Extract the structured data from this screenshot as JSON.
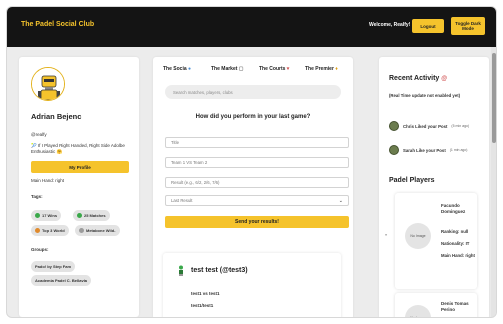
{
  "header": {
    "brand": "The Padel Social Club",
    "welcome": "Welcome, Realfy!",
    "logout_label": "Logout",
    "toggle_dark_label": "Toggle Dark Mode"
  },
  "profile": {
    "name": "Adrian Bejenc",
    "handle": "@realfy",
    "bio": "🎾 If I Played Right Handed, Right Side Adolbe Enthusiastic 🤗",
    "my_profile_label": "My Profile",
    "main_hand": "Main Hand: right",
    "tags_label": "Tags:",
    "tags": [
      {
        "label": "17 Wins",
        "color": "#3aa84a"
      },
      {
        "label": "25 Matches",
        "color": "#3aa84a"
      },
      {
        "label": "Top 3 World",
        "color": "#e08a2c"
      },
      {
        "label": "Metabone Wild-",
        "color": "#9c9c9c"
      }
    ],
    "groups_label": "Groups:",
    "groups": [
      "Pado! by Step Fam",
      "Academia Padel C. Bellavia"
    ]
  },
  "center": {
    "tabs": [
      {
        "label": "The Socia",
        "icon": "globe-icon"
      },
      {
        "label": "The Market",
        "icon": "cart-icon"
      },
      {
        "label": "The Courts",
        "icon": "pin-icon"
      },
      {
        "label": "The Premier",
        "icon": "trophy-icon"
      }
    ],
    "search_placeholder": "Search matches, players, clubs",
    "form_title": "How did you perform in your last game?",
    "fields": [
      {
        "placeholder": "Title"
      },
      {
        "placeholder": "Team 1 VS Team 2"
      },
      {
        "placeholder": "Result (e.g., 6/2, 2/6, 7/6)"
      }
    ],
    "select_value": "Last Result",
    "submit_label": "Send your results!",
    "post": {
      "author": "test test (@test3)",
      "line1": "test1 vs test1",
      "line2": "test1/test1"
    }
  },
  "activity": {
    "title": "Recent Activity",
    "subtitle": "(Real Time update not enabled yet)",
    "items": [
      {
        "text": "Chris Liked your Post",
        "time": "(5 min ago)"
      },
      {
        "text": "Sarah Like your Post",
        "time": "(1 min ago)"
      }
    ]
  },
  "players": {
    "title": "Padel Players",
    "no_image_label": "No Image",
    "cards": [
      {
        "name": "Facundo Dominguez",
        "ranking": "Ranking: null",
        "nationality": "Nationality: IT",
        "main_hand": "Main Hand: right"
      },
      {
        "name": "Denis Tomas Perino"
      }
    ]
  }
}
